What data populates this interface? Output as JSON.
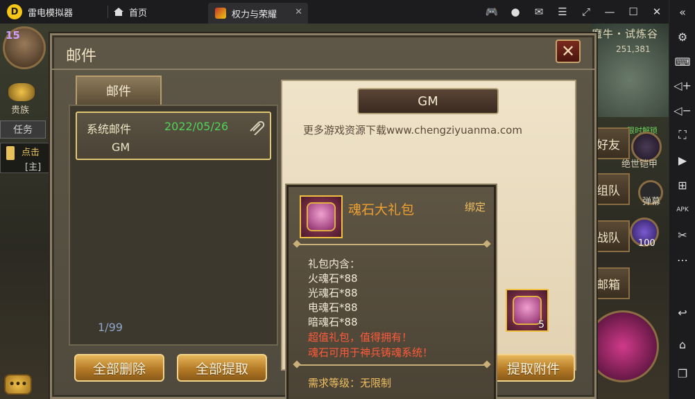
{
  "emulator": {
    "app_name": "雷电模拟器",
    "home_tab": "首页",
    "game_tab": "权力与荣耀"
  },
  "hud": {
    "level": "15",
    "noble_label": "贵族",
    "task_label": "任务",
    "quest_text": "点击",
    "quest_sub": "[主]",
    "map_name": "魔牛・试炼谷",
    "coords": "251,381",
    "side_buttons": [
      "好友",
      "组队",
      "战队",
      "邮箱"
    ],
    "item_count": "100",
    "bullet_label": "弹幕",
    "equip_label": "绝世铠甲",
    "limited_label": "限时解锁"
  },
  "mail": {
    "title": "邮件",
    "tab_label": "邮件",
    "items": [
      {
        "type": "系统邮件",
        "date": "2022/05/26",
        "sender": "GM"
      }
    ],
    "page_count": "1/99",
    "delete_all": "全部删除",
    "extract_all": "全部提取",
    "sender_header": "GM",
    "body": "更多游戏资源下载www.chengziyuanma.com",
    "attachment_count": "5",
    "extract_attachment": "提取附件"
  },
  "tooltip": {
    "name": "魂石大礼包",
    "bind": "绑定",
    "lines_white": [
      "礼包内含：",
      "火魂石*88",
      "光魂石*88",
      "电魂石*88",
      "暗魂石*88"
    ],
    "lines_red": [
      "超值礼包，值得拥有！",
      "魂石可用于神兵铸魂系统！"
    ],
    "requirement": "需求等级：无限制"
  },
  "colors": {
    "gold_accent": "#e3c872",
    "date_green": "#4fd45a",
    "item_name_orange": "#f0a030",
    "warning_red": "#ff5a3a"
  }
}
